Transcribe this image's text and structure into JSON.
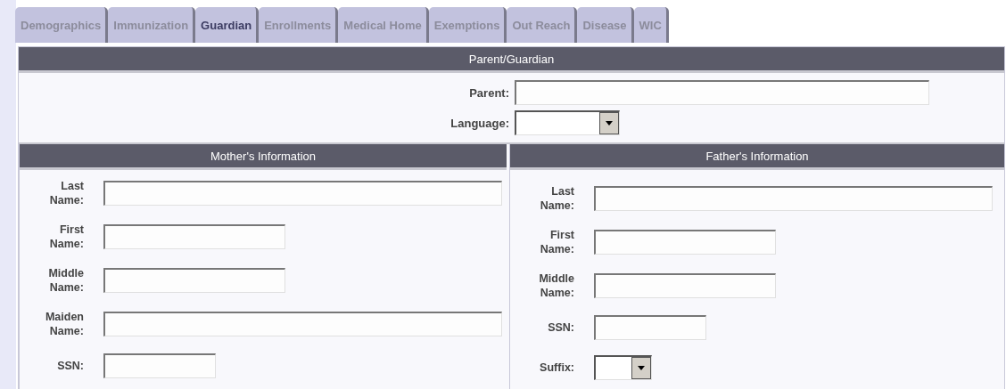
{
  "tabs": [
    {
      "label": "Demographics",
      "selected": false
    },
    {
      "label": "Immunization",
      "selected": false
    },
    {
      "label": "Guardian",
      "selected": true
    },
    {
      "label": "Enrollments",
      "selected": false
    },
    {
      "label": "Medical Home",
      "selected": false
    },
    {
      "label": "Exemptions",
      "selected": false
    },
    {
      "label": "Out Reach",
      "selected": false
    },
    {
      "label": "Disease",
      "selected": false
    },
    {
      "label": "WIC",
      "selected": false
    }
  ],
  "parent_guardian": {
    "title": "Parent/Guardian",
    "fields": [
      {
        "label": "Parent:",
        "kind": "long"
      },
      {
        "label": "Language:",
        "kind": "select"
      }
    ]
  },
  "mother": {
    "title": "Mother's Information",
    "fields": [
      {
        "label": "Last Name:",
        "kind": "long"
      },
      {
        "label": "First Name:",
        "kind": "medium"
      },
      {
        "label": "Middle Name:",
        "kind": "medium"
      },
      {
        "label": "Maiden Name:",
        "kind": "long"
      },
      {
        "label": "SSN:",
        "kind": "short"
      }
    ]
  },
  "father": {
    "title": "Father's Information",
    "fields": [
      {
        "label": "Last Name:",
        "kind": "long"
      },
      {
        "label": "First Name:",
        "kind": "medium"
      },
      {
        "label": "Middle Name:",
        "kind": "medium"
      },
      {
        "label": "SSN:",
        "kind": "short"
      },
      {
        "label": "Suffix:",
        "kind": "small-select"
      }
    ]
  }
}
